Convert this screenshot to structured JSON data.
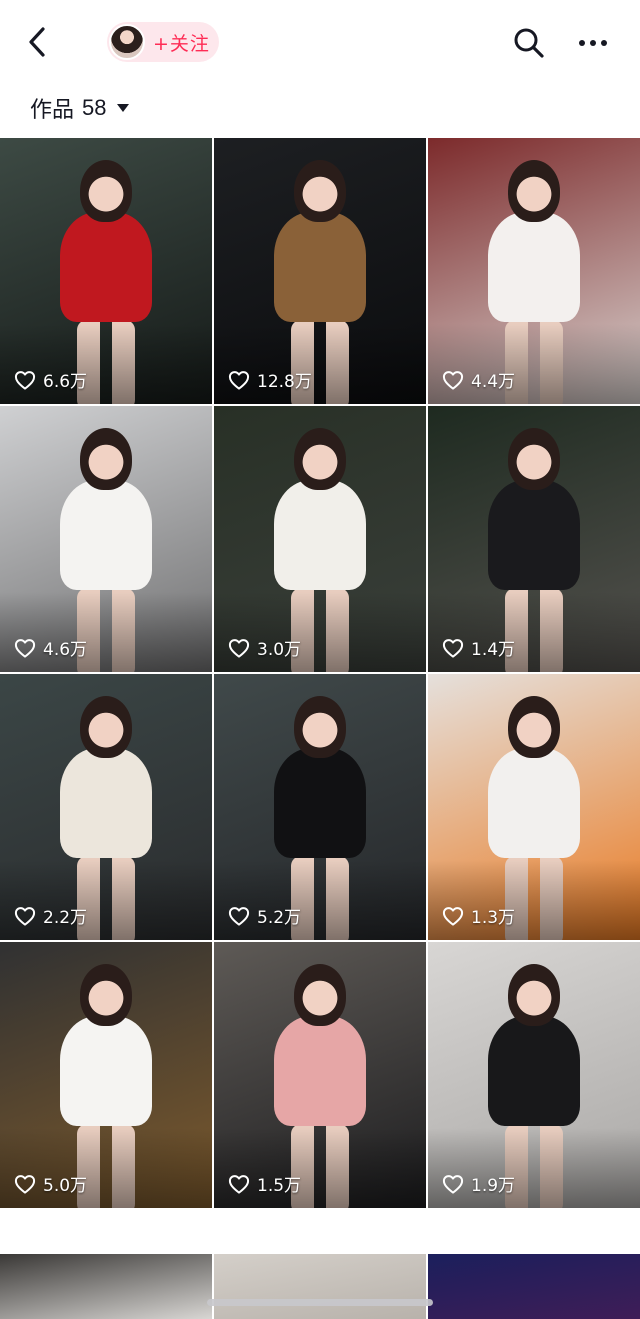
{
  "header": {
    "follow_label": "+关注",
    "back_icon": "chevron-left-icon",
    "search_icon": "search-icon",
    "more_icon": "more-horizontal-icon"
  },
  "section": {
    "title": "作品",
    "count": "58"
  },
  "videos": [
    {
      "likes": "6.6万",
      "bg": [
        "#3d4a44",
        "#151a18"
      ],
      "outfit": "#c0181f"
    },
    {
      "likes": "12.8万",
      "bg": [
        "#1d1f22",
        "#0b0c0e"
      ],
      "outfit": "#8a6138"
    },
    {
      "likes": "4.4万",
      "bg": [
        "#7c2a2b",
        "#d9d2cf"
      ],
      "outfit": "#f3f0ee"
    },
    {
      "likes": "4.6万",
      "bg": [
        "#cfd0d2",
        "#6f6f70"
      ],
      "outfit": "#f4f3f1"
    },
    {
      "likes": "3.0万",
      "bg": [
        "#283026",
        "#3a3f3a"
      ],
      "outfit": "#f1efea"
    },
    {
      "likes": "1.4万",
      "bg": [
        "#1e2a20",
        "#54524e"
      ],
      "outfit": "#1a1a1d"
    },
    {
      "likes": "2.2万",
      "bg": [
        "#3b4646",
        "#2a2c2e"
      ],
      "outfit": "#ece6dc"
    },
    {
      "likes": "5.2万",
      "bg": [
        "#40494a",
        "#25272a"
      ],
      "outfit": "#111113"
    },
    {
      "likes": "1.3万",
      "bg": [
        "#e5e0dc",
        "#e97a22"
      ],
      "outfit": "#f2f0ee"
    },
    {
      "likes": "5.0万",
      "bg": [
        "#303132",
        "#7d5a2c"
      ],
      "outfit": "#f5f4f2"
    },
    {
      "likes": "1.5万",
      "bg": [
        "#5e5a56",
        "#1d1d1f"
      ],
      "outfit": "#e6a6a6"
    },
    {
      "likes": "1.9万",
      "bg": [
        "#d8d6d4",
        "#a9a7a5"
      ],
      "outfit": "#18181a"
    }
  ],
  "partial_videos": [
    {
      "bg": [
        "#3a3836",
        "#d8d6d3"
      ]
    },
    {
      "bg": [
        "#d4cfc9",
        "#b8b2ab"
      ]
    },
    {
      "bg": [
        "#1b1f5c",
        "#3f1d57"
      ]
    }
  ],
  "colors": {
    "accent": "#fe2c55",
    "follow_bg": "#fde7ec",
    "text": "#161823"
  }
}
